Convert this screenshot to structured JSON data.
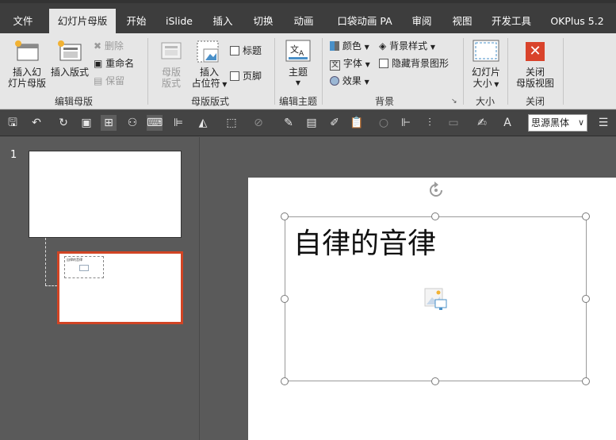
{
  "tabs": [
    {
      "label": "文件",
      "active": false
    },
    {
      "label": "幻灯片母版",
      "active": true
    },
    {
      "label": "开始",
      "active": false
    },
    {
      "label": "iSlide",
      "active": false
    },
    {
      "label": "插入",
      "active": false
    },
    {
      "label": "切换",
      "active": false
    },
    {
      "label": "动画",
      "active": false
    },
    {
      "label": "口袋动画 PA",
      "active": false
    },
    {
      "label": "审阅",
      "active": false
    },
    {
      "label": "视图",
      "active": false
    },
    {
      "label": "开发工具",
      "active": false
    },
    {
      "label": "OKPlus 5.2",
      "active": false
    }
  ],
  "ribbon": {
    "edit_master": {
      "label": "编辑母版",
      "insert_master": [
        "插入幻",
        "灯片母版"
      ],
      "insert_layout": "插入版式",
      "delete": "删除",
      "rename": "重命名",
      "preserve": "保留"
    },
    "master_layout": {
      "label": "母版版式",
      "master_layout_btn": [
        "母版",
        "版式"
      ],
      "insert_placeholder": [
        "插入",
        "占位符"
      ],
      "title_check": "标题",
      "footer_check": "页脚"
    },
    "edit_theme": {
      "label": "编辑主题",
      "theme": "主题"
    },
    "background": {
      "label": "背景",
      "colors": "颜色",
      "fonts": "字体",
      "effects": "效果",
      "bg_styles": "背景样式",
      "hide_bg": "隐藏背景图形"
    },
    "size": {
      "label": "大小",
      "slide_size": [
        "幻灯片",
        "大小"
      ]
    },
    "close": {
      "label": "关闭",
      "close_master": [
        "关闭",
        "母版视图"
      ]
    }
  },
  "quick_toolbar": {
    "font_name": "思源黑体"
  },
  "thumbnails": {
    "slide_number": "1",
    "layout_title": "自律的音律"
  },
  "slide": {
    "title_text": "自律的音律"
  }
}
